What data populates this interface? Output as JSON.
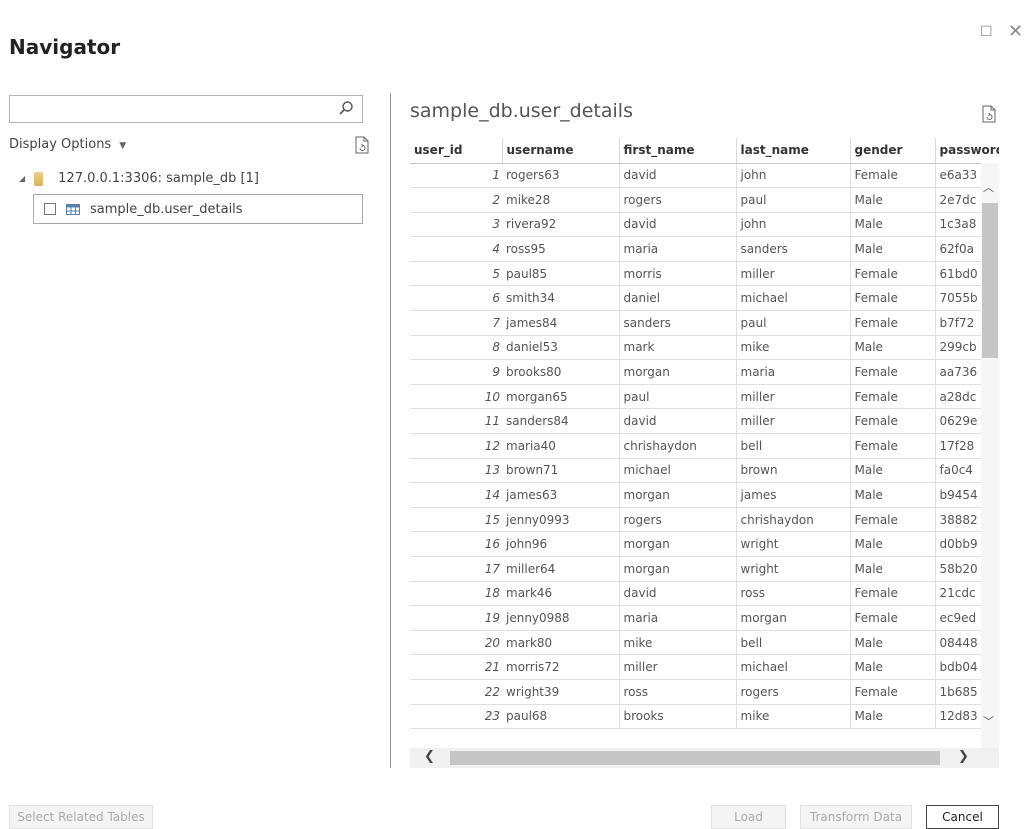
{
  "window": {
    "title": "Navigator",
    "maximize_glyph": "☐",
    "close_glyph": "✕"
  },
  "left": {
    "search": {
      "value": "",
      "placeholder": ""
    },
    "display_options_label": "Display Options",
    "tree": {
      "root_label": "127.0.0.1:3306: sample_db [1]",
      "item_label": "sample_db.user_details"
    }
  },
  "preview": {
    "title": "sample_db.user_details",
    "columns": [
      "user_id",
      "username",
      "first_name",
      "last_name",
      "gender",
      "password"
    ],
    "rows": [
      [
        "1",
        "rogers63",
        "david",
        "john",
        "Female",
        "e6a33"
      ],
      [
        "2",
        "mike28",
        "rogers",
        "paul",
        "Male",
        "2e7dc"
      ],
      [
        "3",
        "rivera92",
        "david",
        "john",
        "Male",
        "1c3a8"
      ],
      [
        "4",
        "ross95",
        "maria",
        "sanders",
        "Male",
        "62f0a"
      ],
      [
        "5",
        "paul85",
        "morris",
        "miller",
        "Female",
        "61bd0"
      ],
      [
        "6",
        "smith34",
        "daniel",
        "michael",
        "Female",
        "7055b"
      ],
      [
        "7",
        "james84",
        "sanders",
        "paul",
        "Female",
        "b7f72"
      ],
      [
        "8",
        "daniel53",
        "mark",
        "mike",
        "Male",
        "299cb"
      ],
      [
        "9",
        "brooks80",
        "morgan",
        "maria",
        "Female",
        "aa736"
      ],
      [
        "10",
        "morgan65",
        "paul",
        "miller",
        "Female",
        "a28dc"
      ],
      [
        "11",
        "sanders84",
        "david",
        "miller",
        "Female",
        "0629e"
      ],
      [
        "12",
        "maria40",
        "chrishaydon",
        "bell",
        "Female",
        "17f28"
      ],
      [
        "13",
        "brown71",
        "michael",
        "brown",
        "Male",
        "fa0c4"
      ],
      [
        "14",
        "james63",
        "morgan",
        "james",
        "Male",
        "b9454"
      ],
      [
        "15",
        "jenny0993",
        "rogers",
        "chrishaydon",
        "Female",
        "38882"
      ],
      [
        "16",
        "john96",
        "morgan",
        "wright",
        "Male",
        "d0bb9"
      ],
      [
        "17",
        "miller64",
        "morgan",
        "wright",
        "Male",
        "58b20"
      ],
      [
        "18",
        "mark46",
        "david",
        "ross",
        "Female",
        "21cdc"
      ],
      [
        "19",
        "jenny0988",
        "maria",
        "morgan",
        "Female",
        "ec9ed"
      ],
      [
        "20",
        "mark80",
        "mike",
        "bell",
        "Male",
        "08448"
      ],
      [
        "21",
        "morris72",
        "miller",
        "michael",
        "Male",
        "bdb04"
      ],
      [
        "22",
        "wright39",
        "ross",
        "rogers",
        "Female",
        "1b685"
      ],
      [
        "23",
        "paul68",
        "brooks",
        "mike",
        "Male",
        "12d83"
      ]
    ]
  },
  "footer": {
    "select_related_label": "Select Related Tables",
    "load_label": "Load",
    "transform_label": "Transform Data",
    "cancel_label": "Cancel"
  }
}
